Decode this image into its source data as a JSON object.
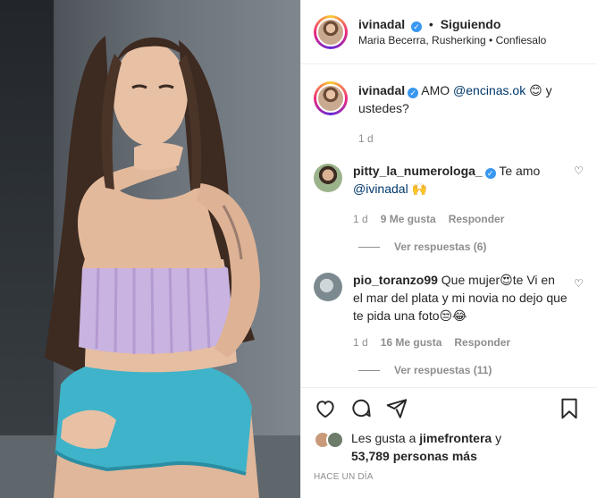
{
  "post": {
    "username": "ivinadal",
    "follow_state": "Siguiendo",
    "audio": "Maria Becerra, Rusherking • Confiesalo"
  },
  "caption": {
    "username": "ivinadal",
    "text_prefix": "AMO",
    "mention": "@encinas.ok",
    "text_suffix": "😊 y ustedes?",
    "age": "1 d"
  },
  "comments": [
    {
      "username": "pitty_la_numerologa_",
      "text": "Te amo",
      "mention": "@ivinadal",
      "emoji": "🙌",
      "age": "1 d",
      "likes": "9 Me gusta",
      "reply_label": "Responder",
      "view_replies": "Ver respuestas (6)"
    },
    {
      "username": "pio_toranzo99",
      "text": "Que mujer😍te Vi en el mar del plata y mi novia no dejo que te pida una foto😒😂",
      "age": "1 d",
      "likes": "16 Me gusta",
      "reply_label": "Responder",
      "view_replies": "Ver respuestas (11)"
    }
  ],
  "likes_line": {
    "prefix": "Les gusta a",
    "user": "jimefrontera",
    "joiner": "y",
    "count": "53,789 personas más"
  },
  "timestamp": "HACE UN DÍA",
  "icons": {
    "like": "heart-icon",
    "comment": "comment-icon",
    "share": "paper-plane-icon",
    "save": "bookmark-icon",
    "verified": "verified-badge-icon"
  },
  "colors": {
    "verified": "#3897f0",
    "link": "#00376b",
    "muted": "#8e8e8e",
    "top_wear": "#c9b3e0",
    "shorts": "#3fb3c9"
  }
}
